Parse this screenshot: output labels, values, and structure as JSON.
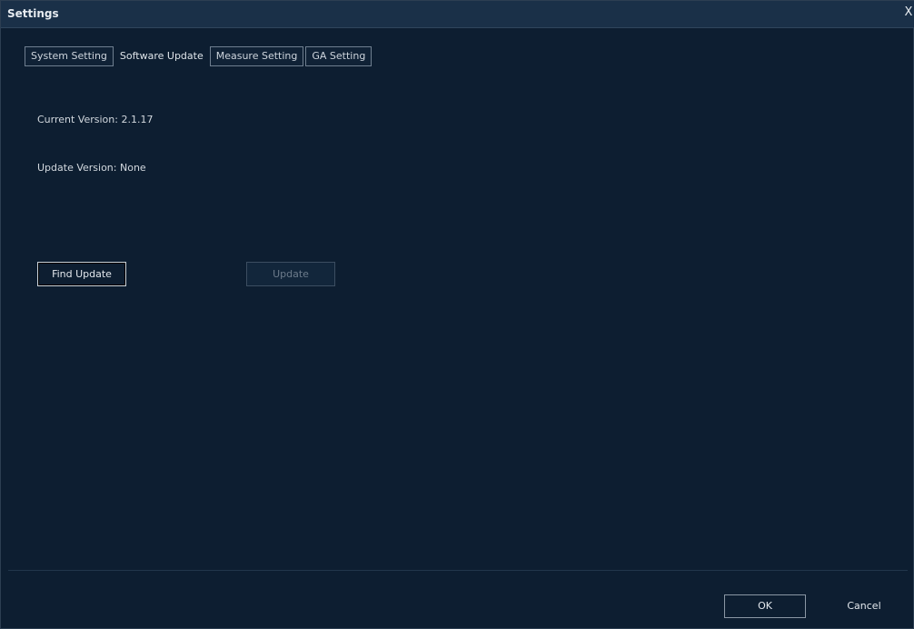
{
  "window": {
    "title": "Settings",
    "close_label": "X"
  },
  "tabs": [
    {
      "label": "System Setting",
      "active": false
    },
    {
      "label": "Software Update",
      "active": true
    },
    {
      "label": "Measure Setting",
      "active": false
    },
    {
      "label": "GA Setting",
      "active": false
    }
  ],
  "software_update": {
    "current_version": "Current Version: 2.1.17",
    "update_version": "Update Version: None",
    "find_update_label": "Find Update",
    "update_label": "Update"
  },
  "footer": {
    "ok_label": "OK",
    "cancel_label": "Cancel"
  },
  "colors": {
    "background": "#0d1e31",
    "titlebar": "#1a3048",
    "text": "#d8dde3",
    "disabled_text": "#6c7b8b"
  }
}
